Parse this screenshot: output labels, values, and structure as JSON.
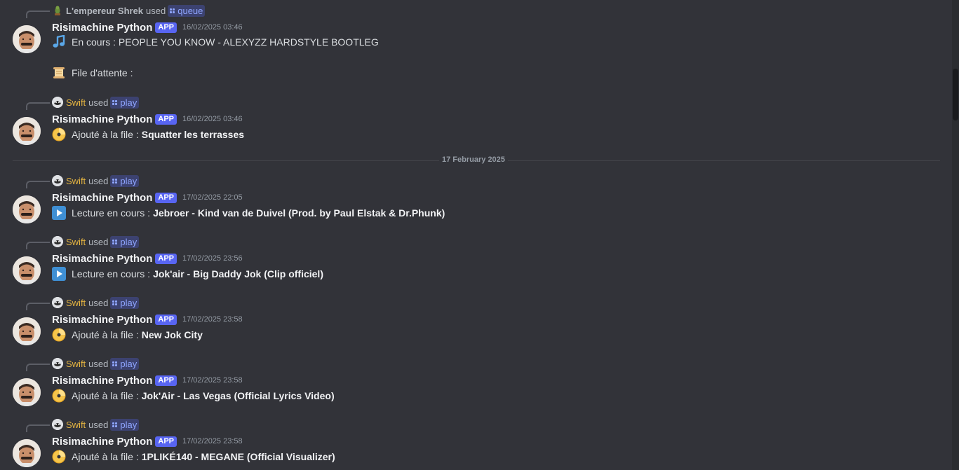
{
  "date_divider": "17 February 2025",
  "messages": [
    {
      "reply_user": "L'empereur Shrek",
      "reply_used": "used",
      "reply_command": "queue",
      "author": "Risimachine Python",
      "badge": "APP",
      "timestamp": "16/02/2025 03:46",
      "lines": [
        {
          "emoji": "musical-note-icon",
          "text": "En cours : PEOPLE YOU KNOW - ALEXYZZ HARDSTYLE BOOTLEG",
          "bold": ""
        },
        {
          "emoji": "scroll-icon",
          "text": "File d'attente :",
          "bold": ""
        }
      ]
    },
    {
      "reply_user": "Swift",
      "reply_used": "used",
      "reply_command": "play",
      "author": "Risimachine Python",
      "badge": "APP",
      "timestamp": "16/02/2025 03:46",
      "lines": [
        {
          "emoji": "dvd-icon",
          "text": "Ajouté à la file :",
          "bold": "Squatter les terrasses"
        }
      ]
    },
    {
      "reply_user": "Swift",
      "reply_used": "used",
      "reply_command": "play",
      "author": "Risimachine Python",
      "badge": "APP",
      "timestamp": "17/02/2025 22:05",
      "lines": [
        {
          "emoji": "play-button-icon",
          "text": "Lecture en cours :",
          "bold": "Jebroer - Kind van de Duivel (Prod. by Paul Elstak & Dr.Phunk)"
        }
      ]
    },
    {
      "reply_user": "Swift",
      "reply_used": "used",
      "reply_command": "play",
      "author": "Risimachine Python",
      "badge": "APP",
      "timestamp": "17/02/2025 23:56",
      "lines": [
        {
          "emoji": "play-button-icon",
          "text": "Lecture en cours :",
          "bold": "Jok'air - Big Daddy Jok (Clip officiel)"
        }
      ]
    },
    {
      "reply_user": "Swift",
      "reply_used": "used",
      "reply_command": "play",
      "author": "Risimachine Python",
      "badge": "APP",
      "timestamp": "17/02/2025 23:58",
      "lines": [
        {
          "emoji": "dvd-icon",
          "text": "Ajouté à la file :",
          "bold": "New Jok City"
        }
      ]
    },
    {
      "reply_user": "Swift",
      "reply_used": "used",
      "reply_command": "play",
      "author": "Risimachine Python",
      "badge": "APP",
      "timestamp": "17/02/2025 23:58",
      "lines": [
        {
          "emoji": "dvd-icon",
          "text": "Ajouté à la file :",
          "bold": "Jok'Air - Las Vegas (Official Lyrics Video)"
        }
      ]
    },
    {
      "reply_user": "Swift",
      "reply_used": "used",
      "reply_command": "play",
      "author": "Risimachine Python",
      "badge": "APP",
      "timestamp": "17/02/2025 23:58",
      "lines": [
        {
          "emoji": "dvd-icon",
          "text": "Ajouté à la file :",
          "bold": "1PLIKÉ140 - MEGANE (Official Visualizer)"
        }
      ]
    }
  ],
  "colors": {
    "background": "#323339",
    "accent": "#5865f2",
    "swift_name": "#e3b341",
    "command": "#8fa6ff"
  }
}
